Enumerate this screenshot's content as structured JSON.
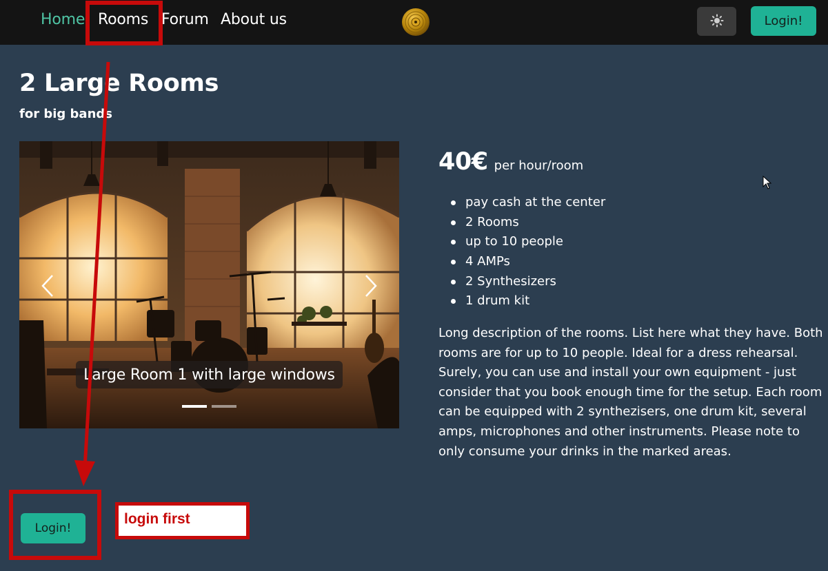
{
  "nav": {
    "links": [
      {
        "label": "Home",
        "active": true
      },
      {
        "label": "Rooms",
        "active": false
      },
      {
        "label": "Forum",
        "active": false
      },
      {
        "label": "About us",
        "active": false
      }
    ],
    "theme_icon": "sun-icon",
    "login_label": "Login!"
  },
  "page": {
    "title": "2 Large Rooms",
    "subtitle": "for big bands"
  },
  "carousel": {
    "caption": "Large Room 1 with large windows",
    "slide_count": 2,
    "active_slide": 1
  },
  "pricing": {
    "amount": "40€",
    "unit": "per hour/room",
    "features": [
      "pay cash at the center",
      "2 Rooms",
      "up to 10 people",
      "4 AMPs",
      "2 Synthesizers",
      "1 drum kit"
    ],
    "description": "Long description of the rooms. List here what they have. Both rooms are for up to 10 people. Ideal for a dress rehearsal. Surely, you can use and install your own equipment - just consider that you book enough time for the setup. Each room can be equipped with 2 synthezisers, one drum kit, several amps, microphones and other instruments. Please note to only consume your drinks in the marked areas."
  },
  "booking": {
    "login_label": "Login!"
  },
  "annotation": {
    "note": "login first"
  },
  "colors": {
    "accent": "#1fb295",
    "background": "#2c3e50",
    "navbar": "#141414",
    "annotation_red": "#c70a0a"
  }
}
